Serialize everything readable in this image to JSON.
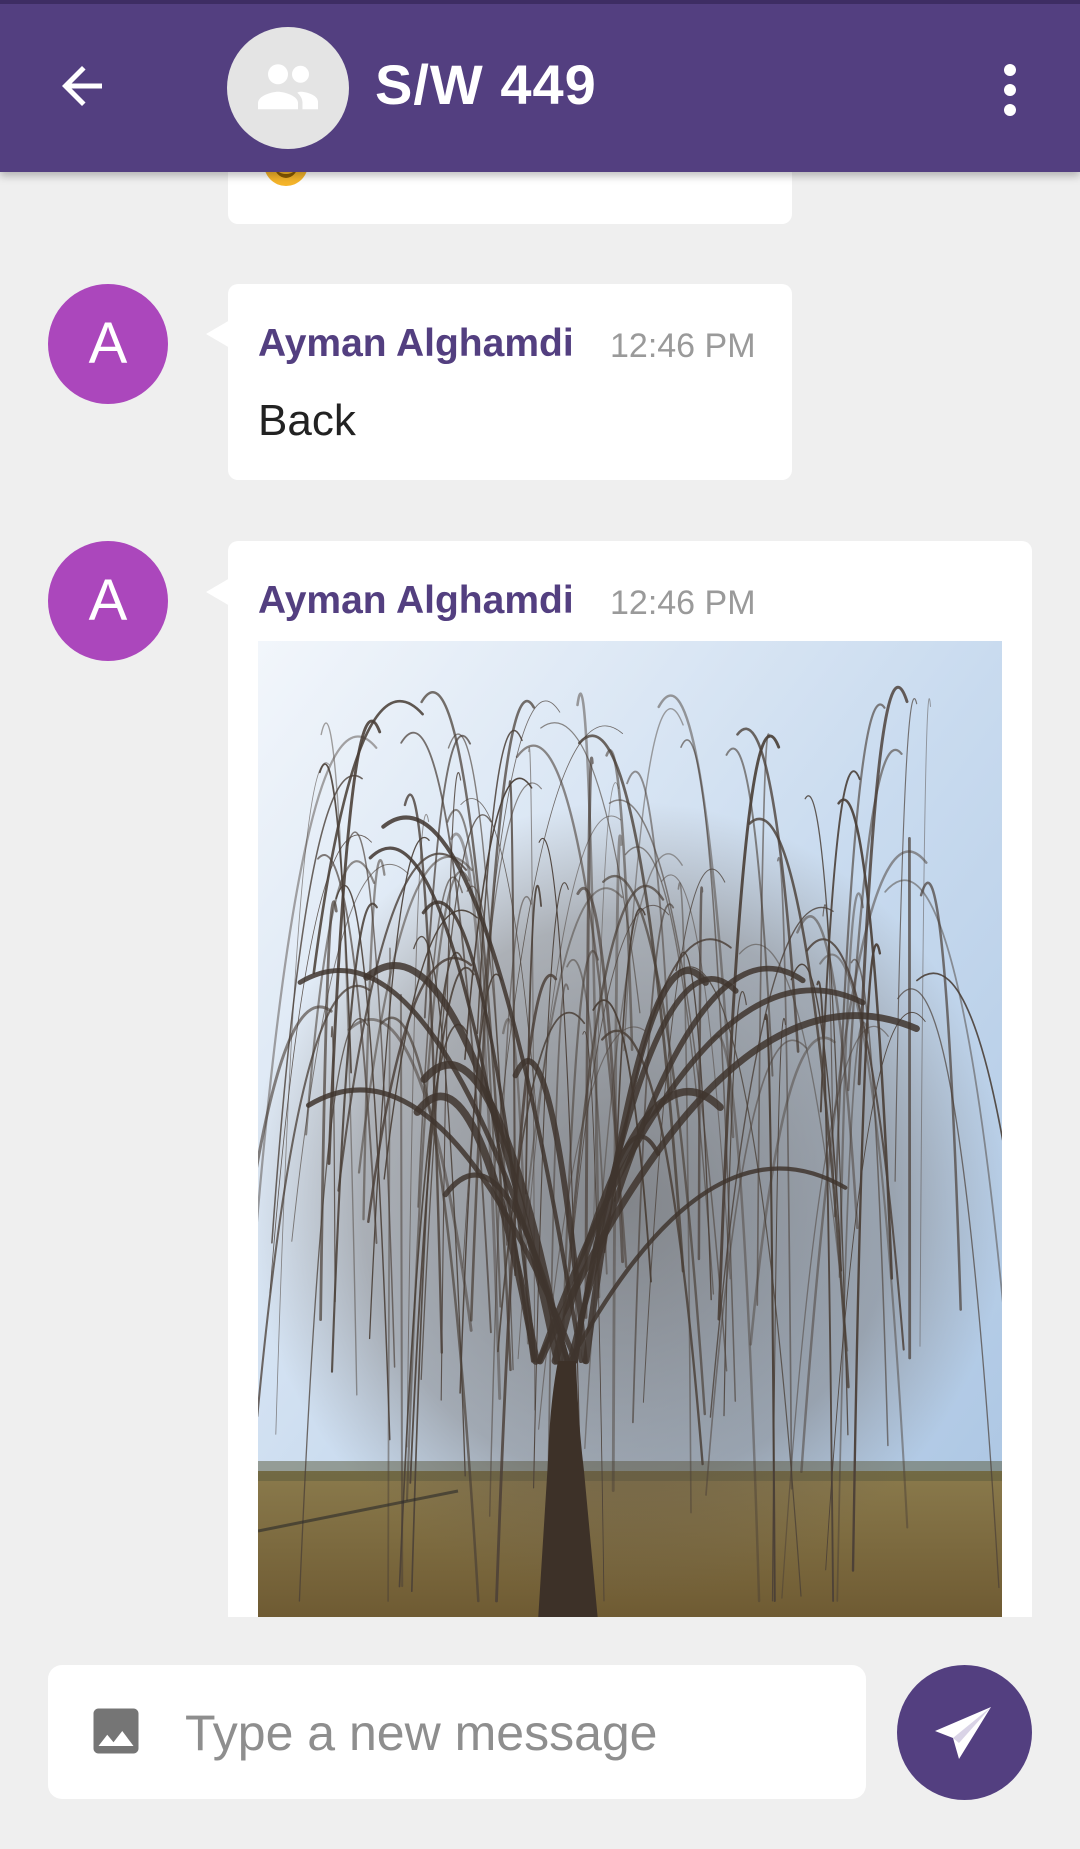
{
  "header": {
    "title": "S/W 449",
    "back_icon": "arrow-left-icon",
    "group_icon": "group-icon",
    "menu_icon": "more-vertical-icon",
    "color": "#533f80"
  },
  "messages": [
    {
      "sender": "",
      "time": "",
      "text": "",
      "emoji": "smiling-face-emoji"
    },
    {
      "avatar_letter": "A",
      "sender": "Ayman Alghamdi",
      "time": "12:46 PM",
      "text": "Back"
    },
    {
      "avatar_letter": "A",
      "sender": "Ayman Alghamdi",
      "time": "12:46 PM",
      "image": "photo of a bare weeping willow tree"
    }
  ],
  "composer": {
    "placeholder": "Type a new message",
    "attach_icon": "image-icon",
    "send_icon": "send-icon"
  },
  "colors": {
    "accent": "#533f80",
    "avatar": "#ab47bc",
    "background": "#efefef"
  }
}
